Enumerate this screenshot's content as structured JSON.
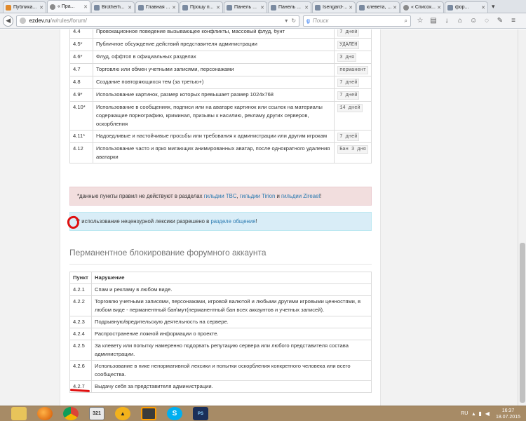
{
  "browser": {
    "tabs": [
      {
        "label": "Публика...",
        "icon": "orange"
      },
      {
        "label": "« Пра...",
        "icon": "wiki",
        "active": true
      },
      {
        "label": "Brotherh...",
        "icon": "default"
      },
      {
        "label": "Главная ...",
        "icon": "default"
      },
      {
        "label": "Прошу п...",
        "icon": "default"
      },
      {
        "label": "Панель ...",
        "icon": "default"
      },
      {
        "label": "Панель ...",
        "icon": "default"
      },
      {
        "label": "Isengard-...",
        "icon": "default"
      },
      {
        "label": "клевета, ...",
        "icon": "default"
      },
      {
        "label": "« Список...",
        "icon": "wiki"
      },
      {
        "label": "фор...",
        "icon": "default"
      }
    ],
    "tab_overflow": "▾",
    "url_host": "ezdev.ru",
    "url_path": "/w/rules/forum/",
    "search_placeholder": "Поиск",
    "search_engine": "g"
  },
  "table1": {
    "rows": [
      {
        "num": "4.4",
        "text": "Провокационное поведение вызывающее конфликты, массовый флуд, бунт",
        "dur": "7 дней"
      },
      {
        "num": "4.5*",
        "text": "Публичное обсуждение действий представителя администрации",
        "dur": "УДАЛЕН"
      },
      {
        "num": "4.6*",
        "text": "Флуд, оффтоп в официальных разделах",
        "dur": "3 дня"
      },
      {
        "num": "4.7",
        "text": "Торговлю или обмен учетными записями, персонажами",
        "dur": "перманент"
      },
      {
        "num": "4.8",
        "text": "Создание повторяющихся тем (за третью+)",
        "dur": "7 дней"
      },
      {
        "num": "4.9*",
        "text": "Использование картинок, размер которых превышает размер 1024x768",
        "dur": "7 дней"
      },
      {
        "num": "4.10*",
        "text": "Использование в сообщениях, подписи или на аватаре картинок или ссылок на материалы содержащие порнографию, криминал, призывы к насилию, рекламу других серверов, оскорбления",
        "dur": "14 дней"
      },
      {
        "num": "4.11*",
        "text": "Надоедливые и настойчивые просьбы или требования к администрации или другим игрокам",
        "dur": "7 дней"
      },
      {
        "num": "4.12",
        "text": "Использование часто и ярко мигающих анимированных аватар, после однократного удаления аватарки",
        "dur": "Бан 3 дня"
      }
    ]
  },
  "alert_red": {
    "prefix": "*данные пункты правил не действуют в разделах ",
    "link1": "гильдии TBC",
    "sep1": ", ",
    "link2": "гильдии Tirion",
    "sep2": " и ",
    "link3": "гильдии Zireael",
    "suffix": "!"
  },
  "alert_blue": {
    "prefix": "** использование нецензурной лексики разрешено в ",
    "link": "разделе общения",
    "suffix": "!"
  },
  "section_title": "Перманентное блокирование форумного аккаунта",
  "table2": {
    "col_num": "Пункт",
    "col_violation": "Нарушение",
    "rows": [
      {
        "num": "4.2.1",
        "text": "Спам и рекламу в любом виде."
      },
      {
        "num": "4.2.2",
        "text": "Торговлю учетными записями, персонажами, игровой валютой и любыми другими игровыми ценностями, в любом виде - перманентный бан\\мут(перманентный бан всех аккаунтов и учетных записей)."
      },
      {
        "num": "4.2.3",
        "text": "Подрывную/вредительскую деятельность на сервере."
      },
      {
        "num": "4.2.4",
        "text": "Распространение ложной информации о проекте."
      },
      {
        "num": "4.2.5",
        "text": "За клевету или попытку намеренно подорвать репутацию сервера или любого представителя состава администрации."
      },
      {
        "num": "4.2.6",
        "text": "Использование в нике ненормативной лексики и попытки оскорбления конкретного человека или всего сообщества."
      },
      {
        "num": "4.2.7",
        "text": "Выдачу себя за представителя администрации."
      }
    ]
  },
  "taskbar": {
    "calendar_day": "321",
    "ps_label": "PS",
    "lang": "RU",
    "time": "16:37",
    "date": "18.07.2015"
  }
}
